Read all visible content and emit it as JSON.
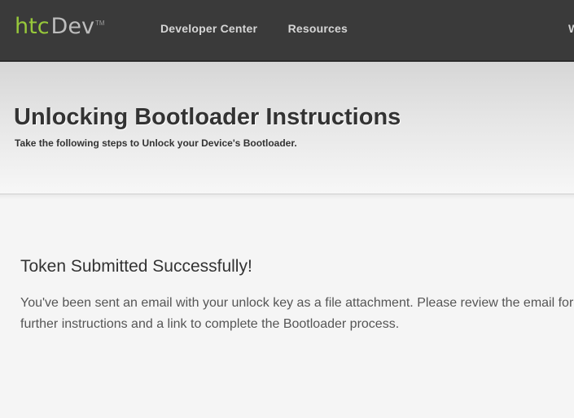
{
  "header": {
    "logo": {
      "primary": "htc",
      "secondary": "Dev",
      "trademark": "TM"
    },
    "nav": [
      {
        "label": "Developer Center"
      },
      {
        "label": "Resources"
      }
    ],
    "nav_cut_label": "W"
  },
  "hero": {
    "title": "Unlocking Bootloader Instructions",
    "subtitle": "Take the following steps to Unlock your Device's Bootloader."
  },
  "message": {
    "title": "Token Submitted Successfully!",
    "body": "You've been sent an email with your unlock key as a file attachment. Please review the email for further instructions and a link to complete the Bootloader process."
  },
  "colors": {
    "topbar": "#3a3a3a",
    "logo_green": "#97c83a",
    "text_dark": "#333333"
  }
}
